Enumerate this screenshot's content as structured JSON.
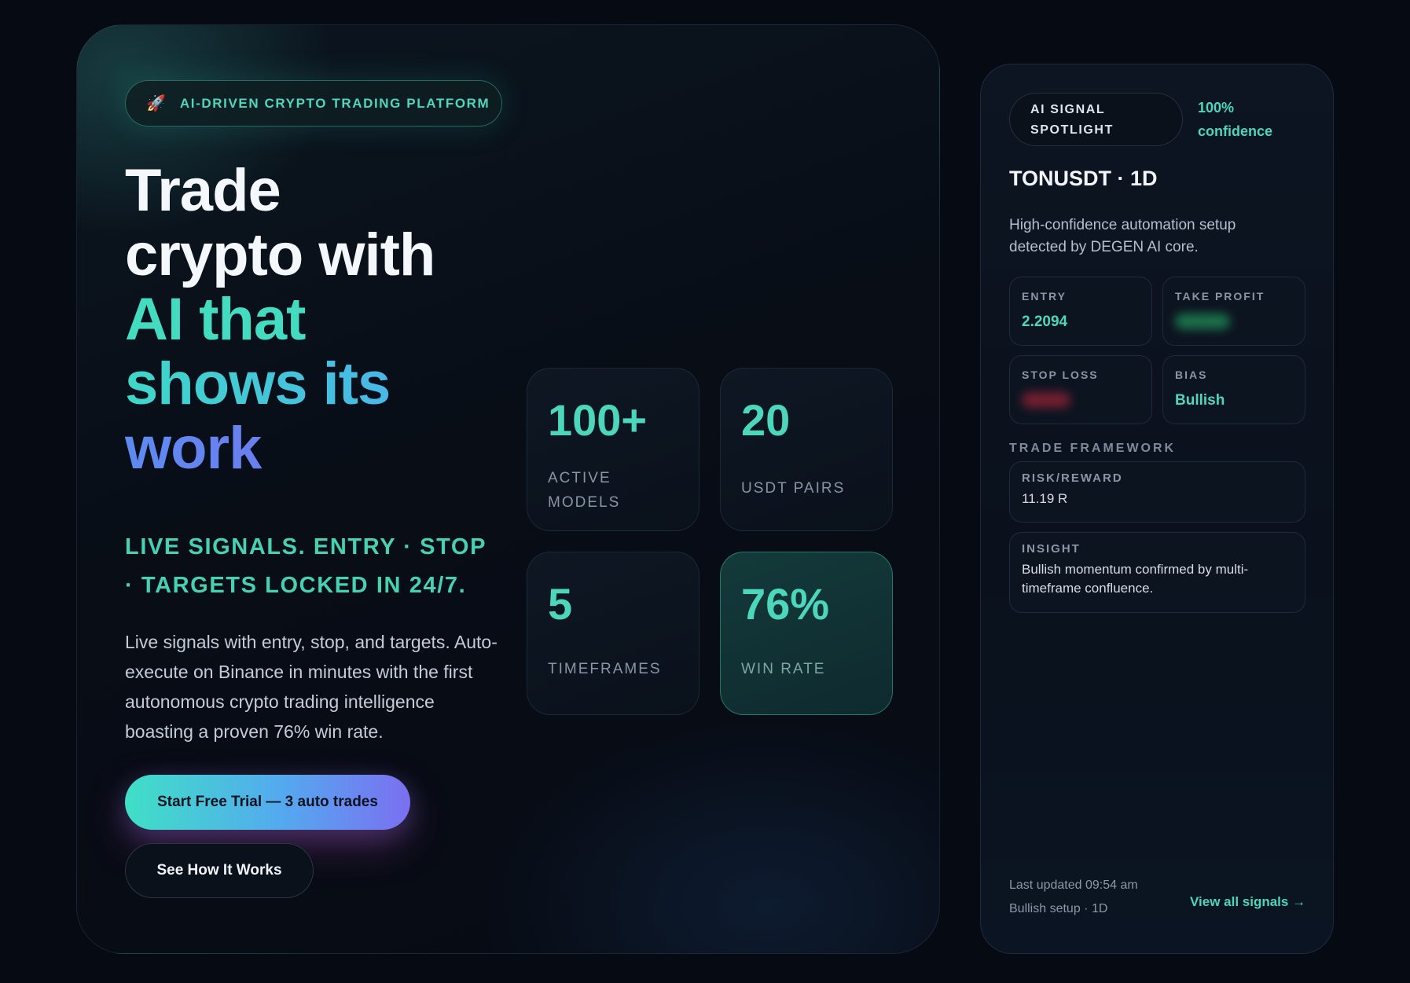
{
  "hero": {
    "badge_icon": "rocket-icon",
    "badge_emoji": "🚀",
    "badge_text": "AI-DRIVEN CRYPTO TRADING PLATFORM",
    "headline": {
      "line1": "Trade",
      "line2": "crypto with",
      "line3": "AI that",
      "line4": "shows its",
      "line5": "work"
    },
    "tagline": "LIVE SIGNALS. ENTRY · STOP · TARGETS LOCKED IN 24/7.",
    "body": "Live signals with entry, stop, and targets. Auto-execute on Binance in minutes with the first autonomous crypto trading intelligence boasting a proven 76% win rate.",
    "primary_button": "Start Free Trial — 3 auto trades",
    "secondary_button": "See How It Works"
  },
  "stats": [
    {
      "value": "100+",
      "label": "ACTIVE MODELS"
    },
    {
      "value": "20",
      "label": "USDT PAIRS"
    },
    {
      "value": "5",
      "label": "TIMEFRAMES"
    },
    {
      "value": "76%",
      "label": "WIN RATE"
    }
  ],
  "signal": {
    "spotlight_label": "AI SIGNAL SPOTLIGHT",
    "confidence": "100% confidence",
    "pair": "TONUSDT · 1D",
    "description": "High-confidence automation setup detected by DEGEN AI core.",
    "entry_label": "ENTRY",
    "entry_value": "2.2094",
    "take_profit_label": "TAKE PROFIT",
    "stop_loss_label": "STOP LOSS",
    "bias_label": "BIAS",
    "bias_value": "Bullish",
    "framework_title": "TRADE FRAMEWORK",
    "risk_reward_label": "RISK/REWARD",
    "risk_reward_value": "11.19 R",
    "insight_label": "INSIGHT",
    "insight_value": "Bullish momentum confirmed by multi-timeframe confluence.",
    "last_updated": "Last updated 09:54 am",
    "setup_note": "Bullish setup · 1D",
    "view_all": "View all signals →"
  },
  "colors": {
    "accent": "#4cd6bb",
    "background": "#060a12",
    "gradient_blue": "#54a9ef",
    "gradient_purple": "#7b6ff0"
  }
}
